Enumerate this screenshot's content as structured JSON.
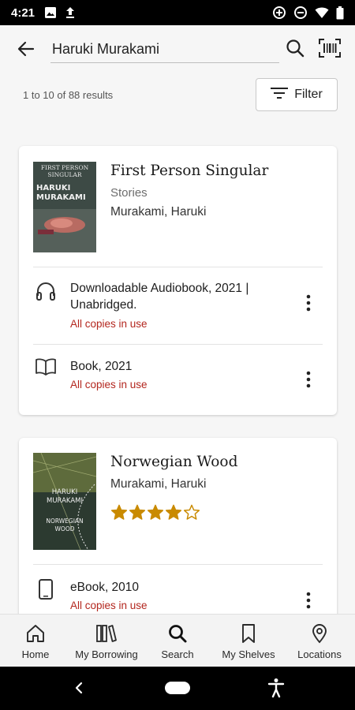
{
  "status_bar": {
    "time": "4:21",
    "icons": [
      "image-icon",
      "upload-icon",
      "data-saver-icon",
      "do-not-disturb-icon",
      "wifi-icon",
      "battery-icon"
    ]
  },
  "search": {
    "value": "Haruki Murakami",
    "back_icon": "arrow-left-icon",
    "search_icon": "search-icon",
    "barcode_icon": "barcode-scan-icon"
  },
  "results": {
    "count_text": "1 to 10 of 88 results",
    "filter_label": "Filter"
  },
  "books": [
    {
      "title": "First Person Singular",
      "subtitle": "Stories",
      "author": "Murakami, Haruki",
      "cover_text": [
        "FIRST PERSON",
        "SINGULAR",
        "HARUKI",
        "MURAKAMI"
      ],
      "formats": [
        {
          "icon": "headphones-icon",
          "label": "Downloadable Audiobook, 2021 | Unabridged.",
          "status": "All copies in use"
        },
        {
          "icon": "book-open-icon",
          "label": "Book, 2021",
          "status": "All copies in use"
        }
      ]
    },
    {
      "title": "Norwegian Wood",
      "author": "Murakami, Haruki",
      "rating": 4,
      "rating_max": 5,
      "cover_text": [
        "HARUKI",
        "MURAKAMI",
        "NORWEGIAN",
        "WOOD"
      ],
      "formats": [
        {
          "icon": "tablet-icon",
          "label": "eBook, 2010",
          "status": "All copies in use"
        }
      ]
    }
  ],
  "bottom_nav": [
    {
      "label": "Home",
      "icon": "home-icon"
    },
    {
      "label": "My Borrowing",
      "icon": "books-icon"
    },
    {
      "label": "Search",
      "icon": "search-icon"
    },
    {
      "label": "My Shelves",
      "icon": "bookmark-icon"
    },
    {
      "label": "Locations",
      "icon": "location-pin-icon"
    }
  ],
  "colors": {
    "status_red": "#b3261e",
    "star_gold": "#c98a00",
    "background": "#f6f6f6"
  }
}
